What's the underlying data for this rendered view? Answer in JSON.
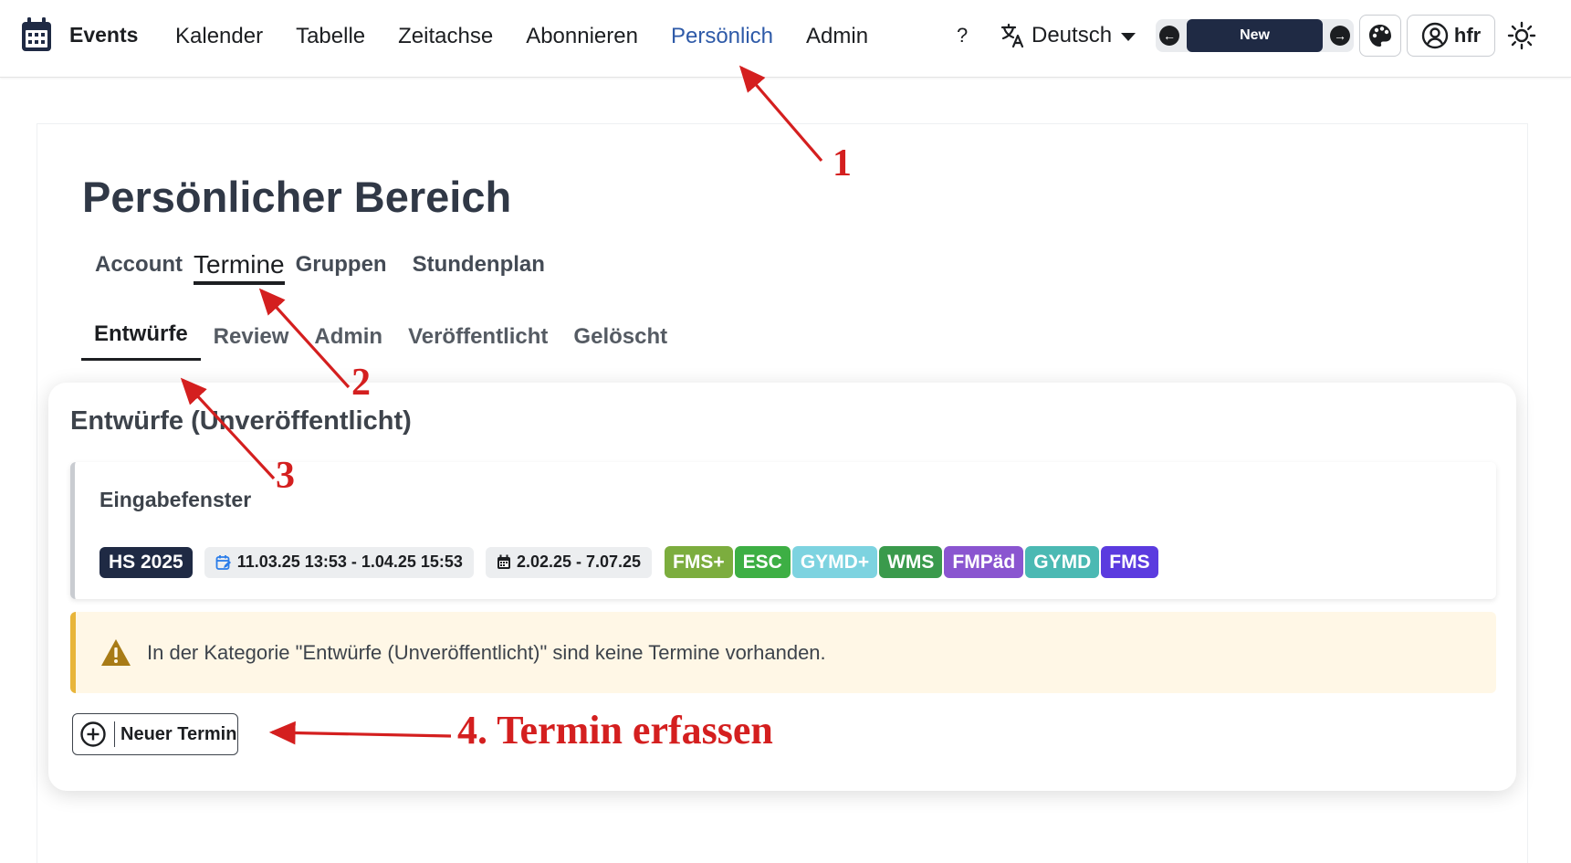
{
  "brand": {
    "title": "Events",
    "icon": "calendar-icon"
  },
  "nav": {
    "items": [
      {
        "label": "Kalender",
        "active": false
      },
      {
        "label": "Tabelle",
        "active": false
      },
      {
        "label": "Zeitachse",
        "active": false
      },
      {
        "label": "Abonnieren",
        "active": false
      },
      {
        "label": "Persönlich",
        "active": true
      },
      {
        "label": "Admin",
        "active": false
      }
    ],
    "help_label": "?",
    "language": {
      "label": "Deutsch",
      "icon": "translate-icon"
    },
    "pager": {
      "prev_icon": "arrow-left-icon",
      "label": "New",
      "next_icon": "arrow-right-icon"
    },
    "palette_icon": "palette-icon",
    "user": {
      "label": "hfr",
      "icon": "user-circle-icon"
    },
    "theme_icon": "sun-icon"
  },
  "page": {
    "title": "Persönlicher Bereich",
    "tabs": [
      {
        "label": "Account",
        "active": false
      },
      {
        "label": "Termine",
        "active": true
      },
      {
        "label": "Gruppen",
        "active": false
      },
      {
        "label": "Stundenplan",
        "active": false
      }
    ],
    "subtabs": [
      {
        "label": "Entwürfe",
        "active": true
      },
      {
        "label": "Review",
        "active": false
      },
      {
        "label": "Admin",
        "active": false
      },
      {
        "label": "Veröffentlicht",
        "active": false
      },
      {
        "label": "Gelöscht",
        "active": false
      }
    ]
  },
  "section": {
    "title": "Entwürfe (Unveröffentlicht)",
    "period": {
      "name": "Eingabefenster",
      "semester": "HS 2025",
      "edit_range": "11.03.25 13:53 - 1.04.25 15:53",
      "event_range": "2.02.25 - 7.07.25",
      "badges": [
        {
          "label": "FMS+",
          "color": "#7cad3e"
        },
        {
          "label": "ESC",
          "color": "#3daf44"
        },
        {
          "label": "GYMD+",
          "color": "#7dd3e0"
        },
        {
          "label": "WMS",
          "color": "#3a9a4c"
        },
        {
          "label": "FMPäd",
          "color": "#8a55d0"
        },
        {
          "label": "GYMD",
          "color": "#4bb9b3"
        },
        {
          "label": "FMS",
          "color": "#5b3bdf"
        }
      ]
    },
    "alert": {
      "text": "In der Kategorie \"Entwürfe (Unveröffentlicht)\" sind keine Termine vorhanden.",
      "icon": "warning-icon",
      "color": "#e8b53a"
    },
    "new_button": {
      "label": "Neuer Termin",
      "icon": "plus-circle-icon"
    }
  },
  "annotations": {
    "labels": [
      "1",
      "2",
      "3",
      "4. Termin erfassen"
    ],
    "color": "#d41f1f"
  }
}
